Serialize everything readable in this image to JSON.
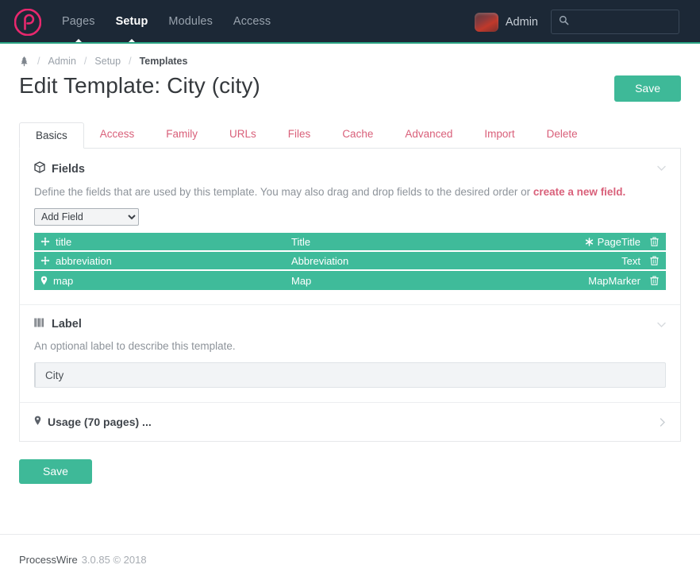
{
  "masthead": {
    "logo_icon": "processwire-logo-icon",
    "nav": [
      {
        "label": "Pages",
        "active": false
      },
      {
        "label": "Setup",
        "active": true
      },
      {
        "label": "Modules",
        "active": false
      },
      {
        "label": "Access",
        "active": false
      }
    ],
    "user": {
      "name": "Admin",
      "avatar_icon": "user-avatar"
    },
    "search": {
      "placeholder": "",
      "value": "",
      "icon": "search-icon"
    }
  },
  "breadcrumb": {
    "home_icon": "tree-home-icon",
    "separator": "/",
    "items": [
      {
        "label": "Admin",
        "current": false
      },
      {
        "label": "Setup",
        "current": false
      },
      {
        "label": "Templates",
        "current": true
      }
    ]
  },
  "header": {
    "title": "Edit Template: City (city)",
    "save_label": "Save"
  },
  "tabs": [
    {
      "label": "Basics",
      "active": true
    },
    {
      "label": "Access",
      "active": false
    },
    {
      "label": "Family",
      "active": false
    },
    {
      "label": "URLs",
      "active": false
    },
    {
      "label": "Files",
      "active": false
    },
    {
      "label": "Cache",
      "active": false
    },
    {
      "label": "Advanced",
      "active": false
    },
    {
      "label": "Import",
      "active": false
    },
    {
      "label": "Delete",
      "active": false
    }
  ],
  "fields_panel": {
    "icon": "cube-icon",
    "title": "Fields",
    "toggle_icon": "chevron-down-icon",
    "description_before": "Define the fields that are used by this template. You may also drag and drop fields to the desired order or ",
    "description_link": "create a new field.",
    "add_field_label": "Add Field",
    "rows": [
      {
        "name": "title",
        "label": "Title",
        "type": "PageTitle",
        "name_icon": "arrows-move-icon",
        "type_icon": "asterisk-icon",
        "delete_icon": "trash-icon"
      },
      {
        "name": "abbreviation",
        "label": "Abbreviation",
        "type": "Text",
        "name_icon": "arrows-move-icon",
        "type_icon": "",
        "delete_icon": "trash-icon"
      },
      {
        "name": "map",
        "label": "Map",
        "type": "MapMarker",
        "name_icon": "map-marker-icon",
        "type_icon": "",
        "delete_icon": "trash-icon"
      }
    ]
  },
  "label_panel": {
    "icon": "barcode-icon",
    "title": "Label",
    "toggle_icon": "chevron-down-icon",
    "description": "An optional label to describe this template.",
    "input_value": "City",
    "input_placeholder": ""
  },
  "usage_panel": {
    "icon": "map-marker-icon",
    "title": "Usage (70 pages) ...",
    "toggle_icon": "chevron-right-icon"
  },
  "footer": {
    "name": "ProcessWire",
    "version": "3.0.85 © 2018"
  },
  "colors": {
    "masthead_bg": "#1c2836",
    "accent_green": "#3fbb9a",
    "accent_pink": "#d9607a",
    "logo_pink": "#e8286e"
  }
}
